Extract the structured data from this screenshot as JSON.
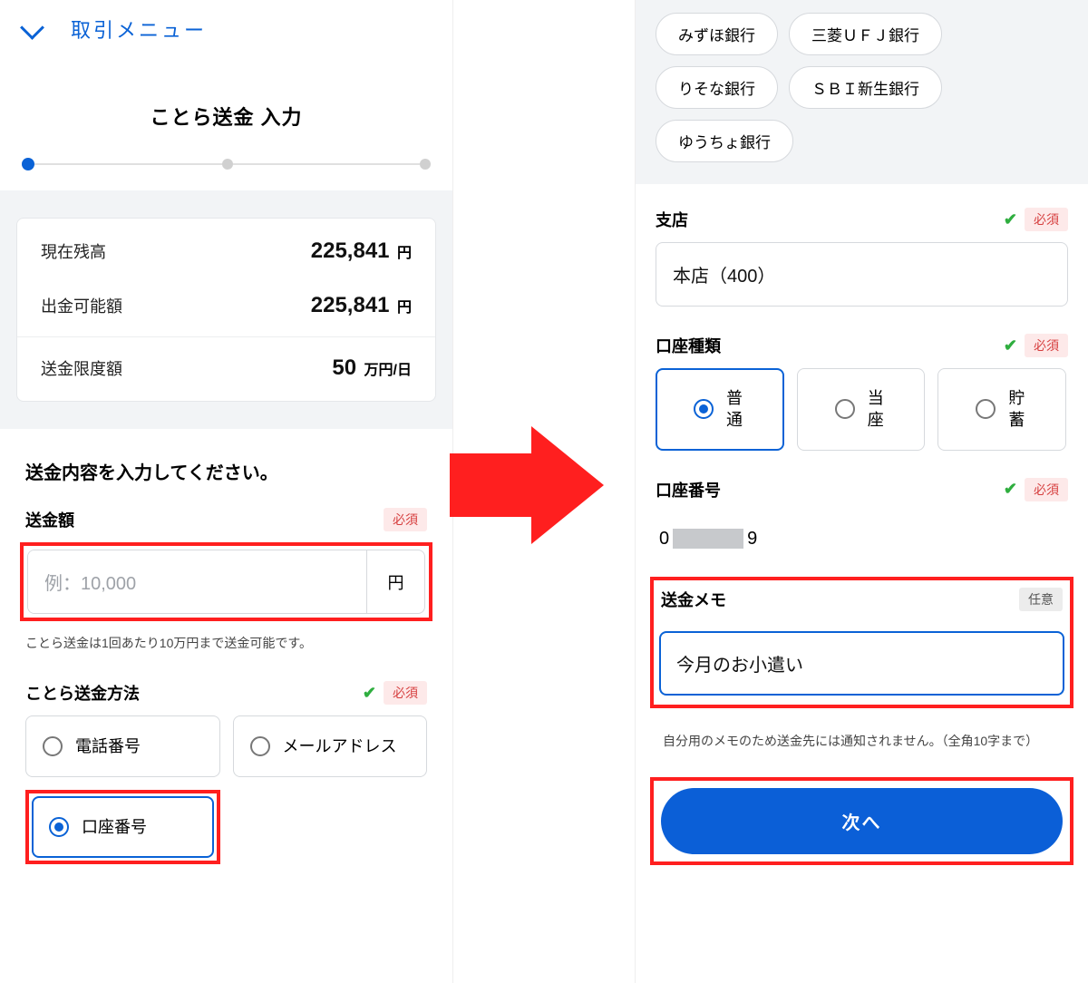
{
  "left": {
    "menu_label": "取引メニュー",
    "page_title": "ことら送金 入力",
    "summary": {
      "balance_label": "現在残高",
      "balance_value": "225,841",
      "balance_unit": "円",
      "withdraw_label": "出金可能額",
      "withdraw_value": "225,841",
      "withdraw_unit": "円",
      "limit_label": "送金限度額",
      "limit_value": "50",
      "limit_unit": "万円/日"
    },
    "prompt": "送金内容を入力してください。",
    "amount": {
      "label": "送金額",
      "placeholder": "例：10,000",
      "unit": "円",
      "required_badge": "必須",
      "note": "ことら送金は1回あたり10万円まで送金可能です。"
    },
    "method": {
      "label": "ことら送金方法",
      "required_badge": "必須",
      "options": {
        "phone": "電話番号",
        "email": "メールアドレス",
        "account": "口座番号"
      }
    }
  },
  "right": {
    "banks": [
      "みずほ銀行",
      "三菱ＵＦＪ銀行",
      "りそな銀行",
      "ＳＢＩ新生銀行",
      "ゆうちょ銀行"
    ],
    "branch": {
      "label": "支店",
      "required_badge": "必須",
      "value": "本店（400）"
    },
    "acct_type": {
      "label": "口座種類",
      "required_badge": "必須",
      "options": {
        "futsu": "普通",
        "touza": "当座",
        "chochiku": "貯蓄"
      }
    },
    "acct_num": {
      "label": "口座番号",
      "required_badge": "必須",
      "prefix": "0",
      "suffix": "9"
    },
    "memo": {
      "label": "送金メモ",
      "optional_badge": "任意",
      "value": "今月のお小遣い",
      "note": "自分用のメモのため送金先には通知されません。（全角10字まで）"
    },
    "next_button": "次へ"
  }
}
